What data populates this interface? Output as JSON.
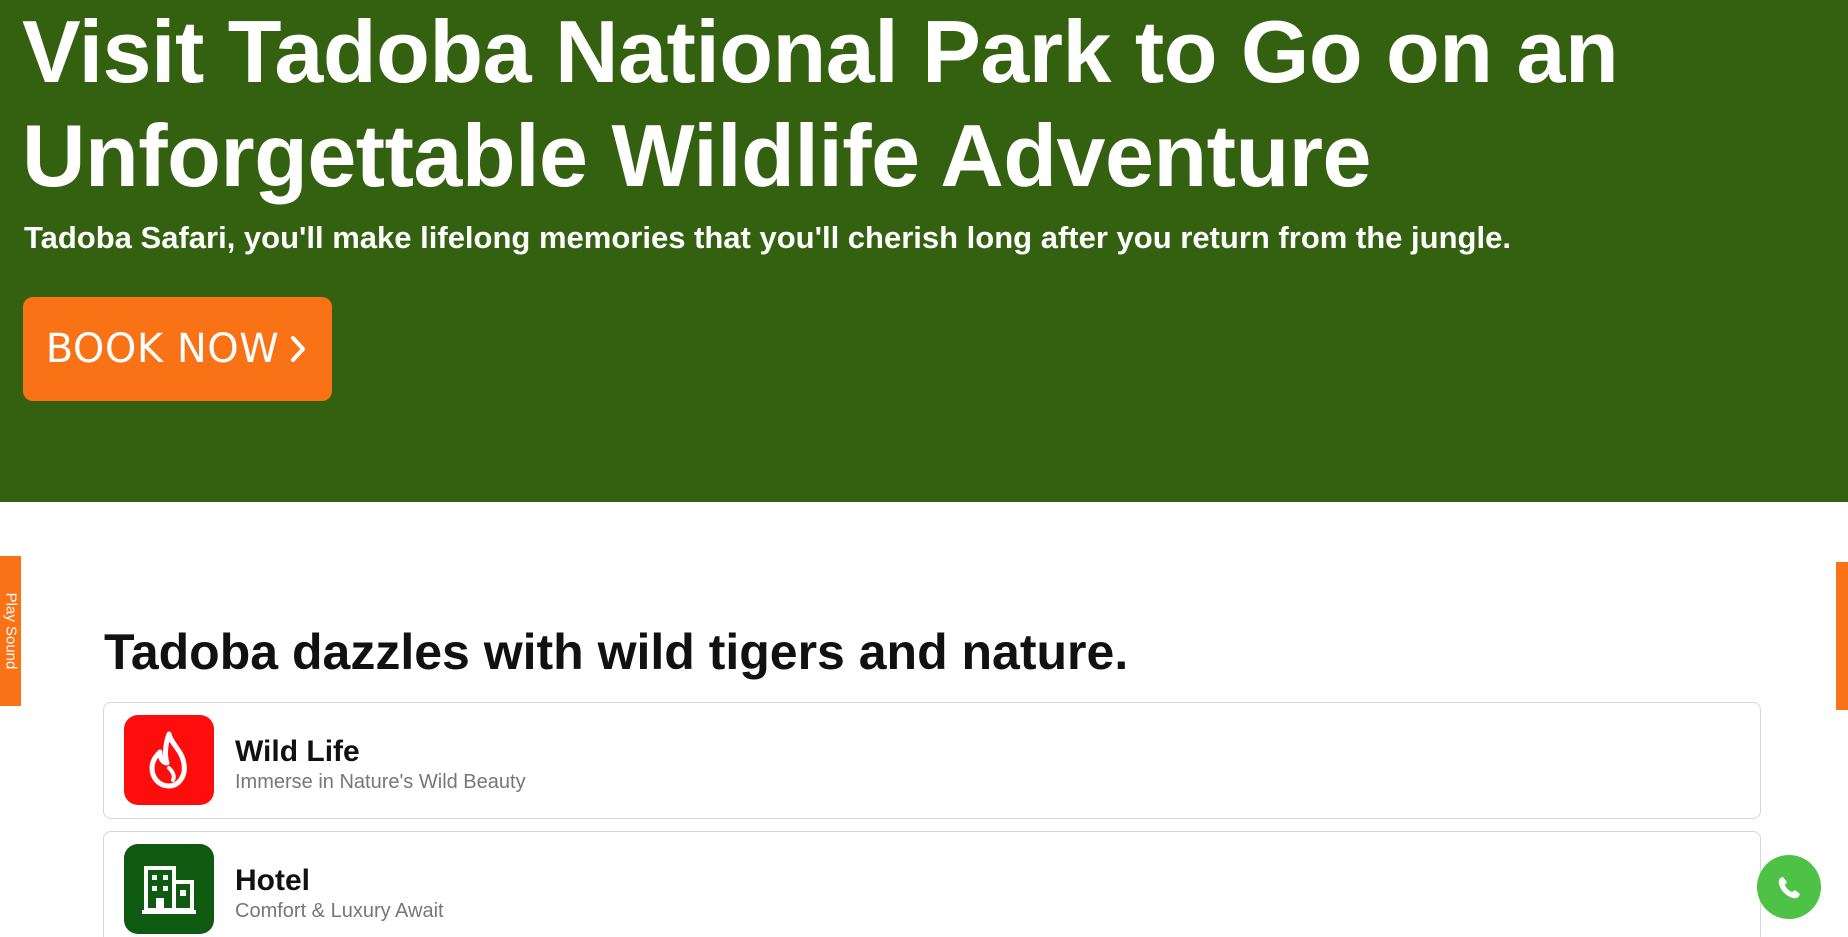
{
  "hero": {
    "title": "Visit Tadoba National Park to Go on an Unforgettable Wildlife Adventure",
    "subtitle": "Tadoba Safari, you'll make lifelong memories that you'll cherish long after you return from the jungle.",
    "book_label": "BOOK NOW",
    "background_color": "#336110",
    "button_color": "#f97316"
  },
  "side_tab": {
    "label": "Play Sound"
  },
  "section": {
    "title": "Tadoba dazzles with wild tigers and nature.",
    "cards": [
      {
        "title": "Wild Life",
        "subtitle": "Immerse in Nature's Wild Beauty",
        "icon": "flame-icon",
        "icon_color": "#ff0d0d"
      },
      {
        "title": "Hotel",
        "subtitle": "Comfort & Luxury Await",
        "icon": "building-icon",
        "icon_color": "#0d5a10"
      }
    ]
  },
  "floating": {
    "whatsapp_icon": "whatsapp-icon",
    "whatsapp_color": "#4dc247"
  }
}
